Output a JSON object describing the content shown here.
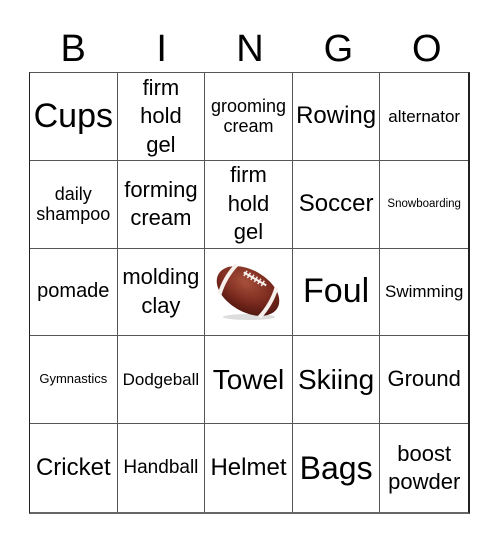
{
  "header": {
    "letters": [
      "B",
      "I",
      "N",
      "G",
      "O"
    ]
  },
  "board": {
    "rows": [
      [
        "Cups",
        "firm\nhold\ngel",
        "grooming\ncream",
        "Rowing",
        "alternator"
      ],
      [
        "daily\nshampoo",
        "forming\ncream",
        "firm\nhold\ngel",
        "Soccer",
        "Snowboarding"
      ],
      [
        "pomade",
        "molding\nclay",
        "[football-image]",
        "Foul",
        "Swimming"
      ],
      [
        "Gymnastics",
        "Dodgeball",
        "Towel",
        "Skiing",
        "Ground"
      ],
      [
        "Cricket",
        "Handball",
        "Helmet",
        "Bags",
        "boost\npowder"
      ]
    ],
    "free_space_icon": "american-football-icon"
  },
  "colors": {
    "ball_brown": "#7a2a1e",
    "lace_white": "#f5f0ec",
    "grid_line": "#555555"
  }
}
